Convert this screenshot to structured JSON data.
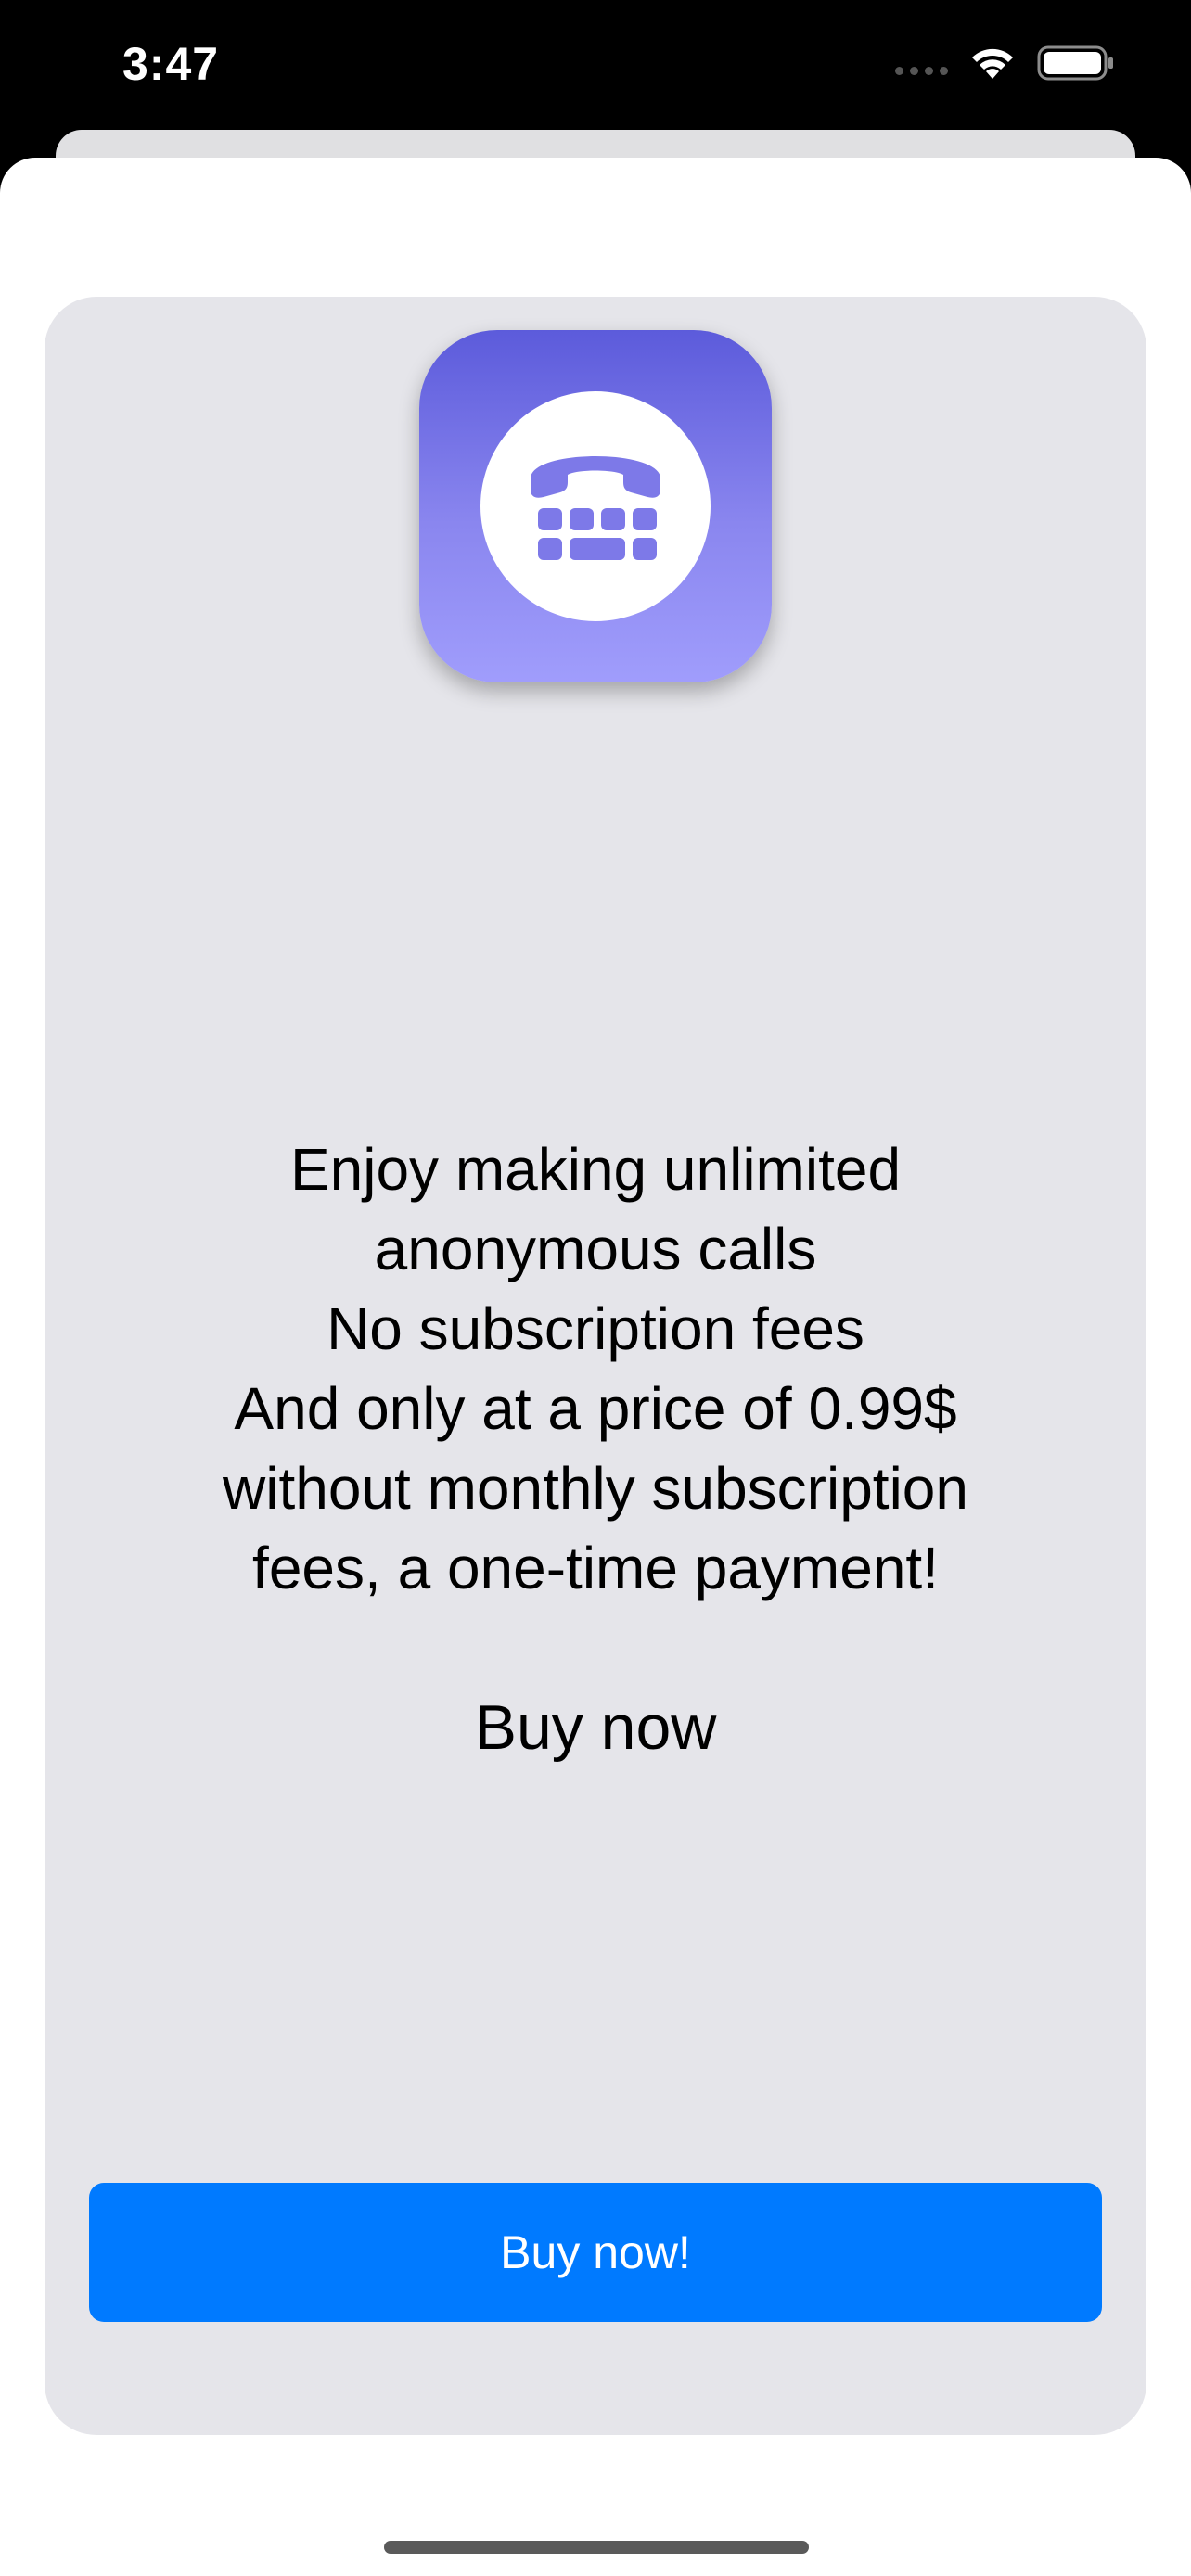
{
  "status_bar": {
    "time": "3:47",
    "icons": [
      "cellular-signal-icon",
      "wifi-icon",
      "battery-icon"
    ]
  },
  "app_icon": {
    "name": "phone-keypad-icon",
    "gradient_top": "#5c5bdb",
    "gradient_bottom": "#a09dfc"
  },
  "message": {
    "lines": [
      "Enjoy making unlimited",
      "anonymous calls",
      "No subscription fees",
      "And only at a price of 0.99$",
      "without monthly subscription",
      "fees, a one-time payment!"
    ],
    "cta_text": "Buy now"
  },
  "buy_button": {
    "label": "Buy now!",
    "color": "#007aff"
  },
  "colors": {
    "card_background": "#e5e5ea",
    "sheet_background": "#ffffff",
    "accent": "#007aff"
  }
}
